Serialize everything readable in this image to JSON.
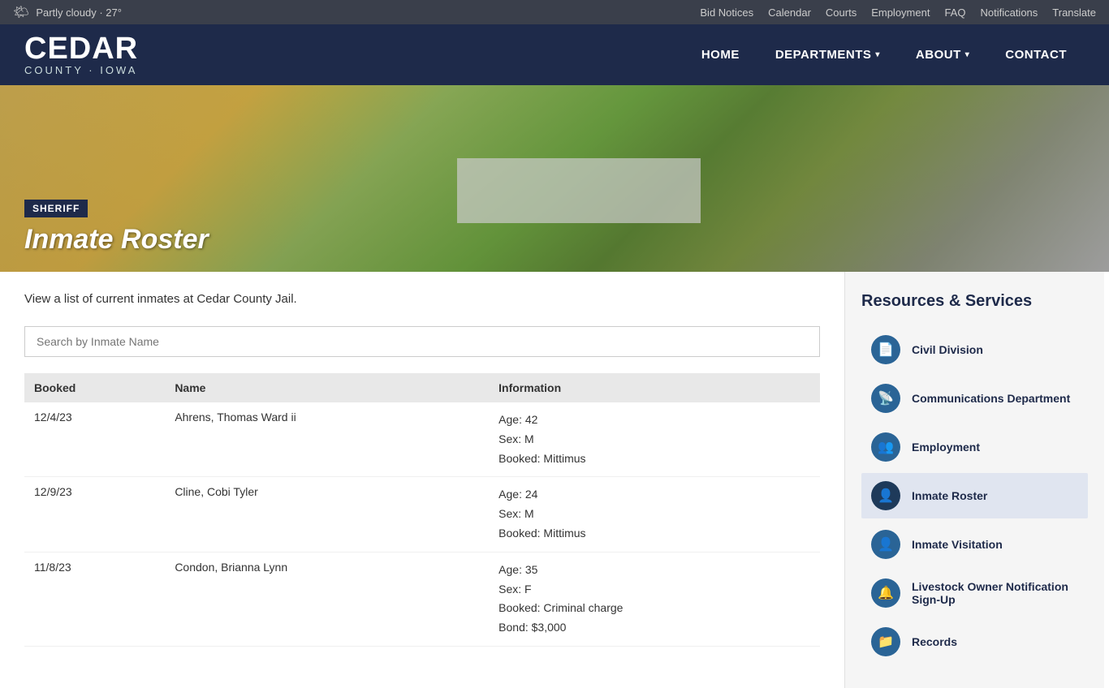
{
  "utility_bar": {
    "weather": "Partly cloudy · 27°",
    "weather_icon": "🌤",
    "links": [
      {
        "label": "Bid Notices",
        "id": "bid-notices"
      },
      {
        "label": "Calendar",
        "id": "calendar"
      },
      {
        "label": "Courts",
        "id": "courts"
      },
      {
        "label": "Employment",
        "id": "employment"
      },
      {
        "label": "FAQ",
        "id": "faq"
      },
      {
        "label": "Notifications",
        "id": "notifications"
      },
      {
        "label": "Translate",
        "id": "translate"
      }
    ]
  },
  "header": {
    "logo_cedar": "CEDAR",
    "logo_sub": "COUNTY · IOWA",
    "nav": [
      {
        "label": "HOME",
        "has_arrow": false
      },
      {
        "label": "DEPARTMENTS",
        "has_arrow": true
      },
      {
        "label": "ABOUT",
        "has_arrow": true
      },
      {
        "label": "CONTACT",
        "has_arrow": false
      }
    ]
  },
  "hero": {
    "breadcrumb": "SHERIFF",
    "title": "Inmate Roster"
  },
  "main": {
    "description": "View a list of current inmates at Cedar County Jail.",
    "search_placeholder": "Search by Inmate Name",
    "table": {
      "columns": [
        "Booked",
        "Name",
        "Information"
      ],
      "rows": [
        {
          "booked": "12/4/23",
          "name": "Ahrens, Thomas Ward ii",
          "info": "Age: 42\nSex: M\nBooked: Mittimus"
        },
        {
          "booked": "12/9/23",
          "name": "Cline, Cobi Tyler",
          "info": "Age: 24\nSex: M\nBooked: Mittimus"
        },
        {
          "booked": "11/8/23",
          "name": "Condon, Brianna Lynn",
          "info": "Age: 35\nSex: F\nBooked: Criminal charge\nBond: $3,000"
        }
      ]
    }
  },
  "sidebar": {
    "title": "Resources & Services",
    "items": [
      {
        "label": "Civil Division",
        "icon": "📄",
        "active": false
      },
      {
        "label": "Communications Department",
        "icon": "📡",
        "active": false
      },
      {
        "label": "Employment",
        "icon": "👥",
        "active": false
      },
      {
        "label": "Inmate Roster",
        "icon": "👤",
        "active": true
      },
      {
        "label": "Inmate Visitation",
        "icon": "👤",
        "active": false
      },
      {
        "label": "Livestock Owner Notification Sign-Up",
        "icon": "🔔",
        "active": false
      },
      {
        "label": "Records",
        "icon": "📁",
        "active": false
      }
    ]
  }
}
